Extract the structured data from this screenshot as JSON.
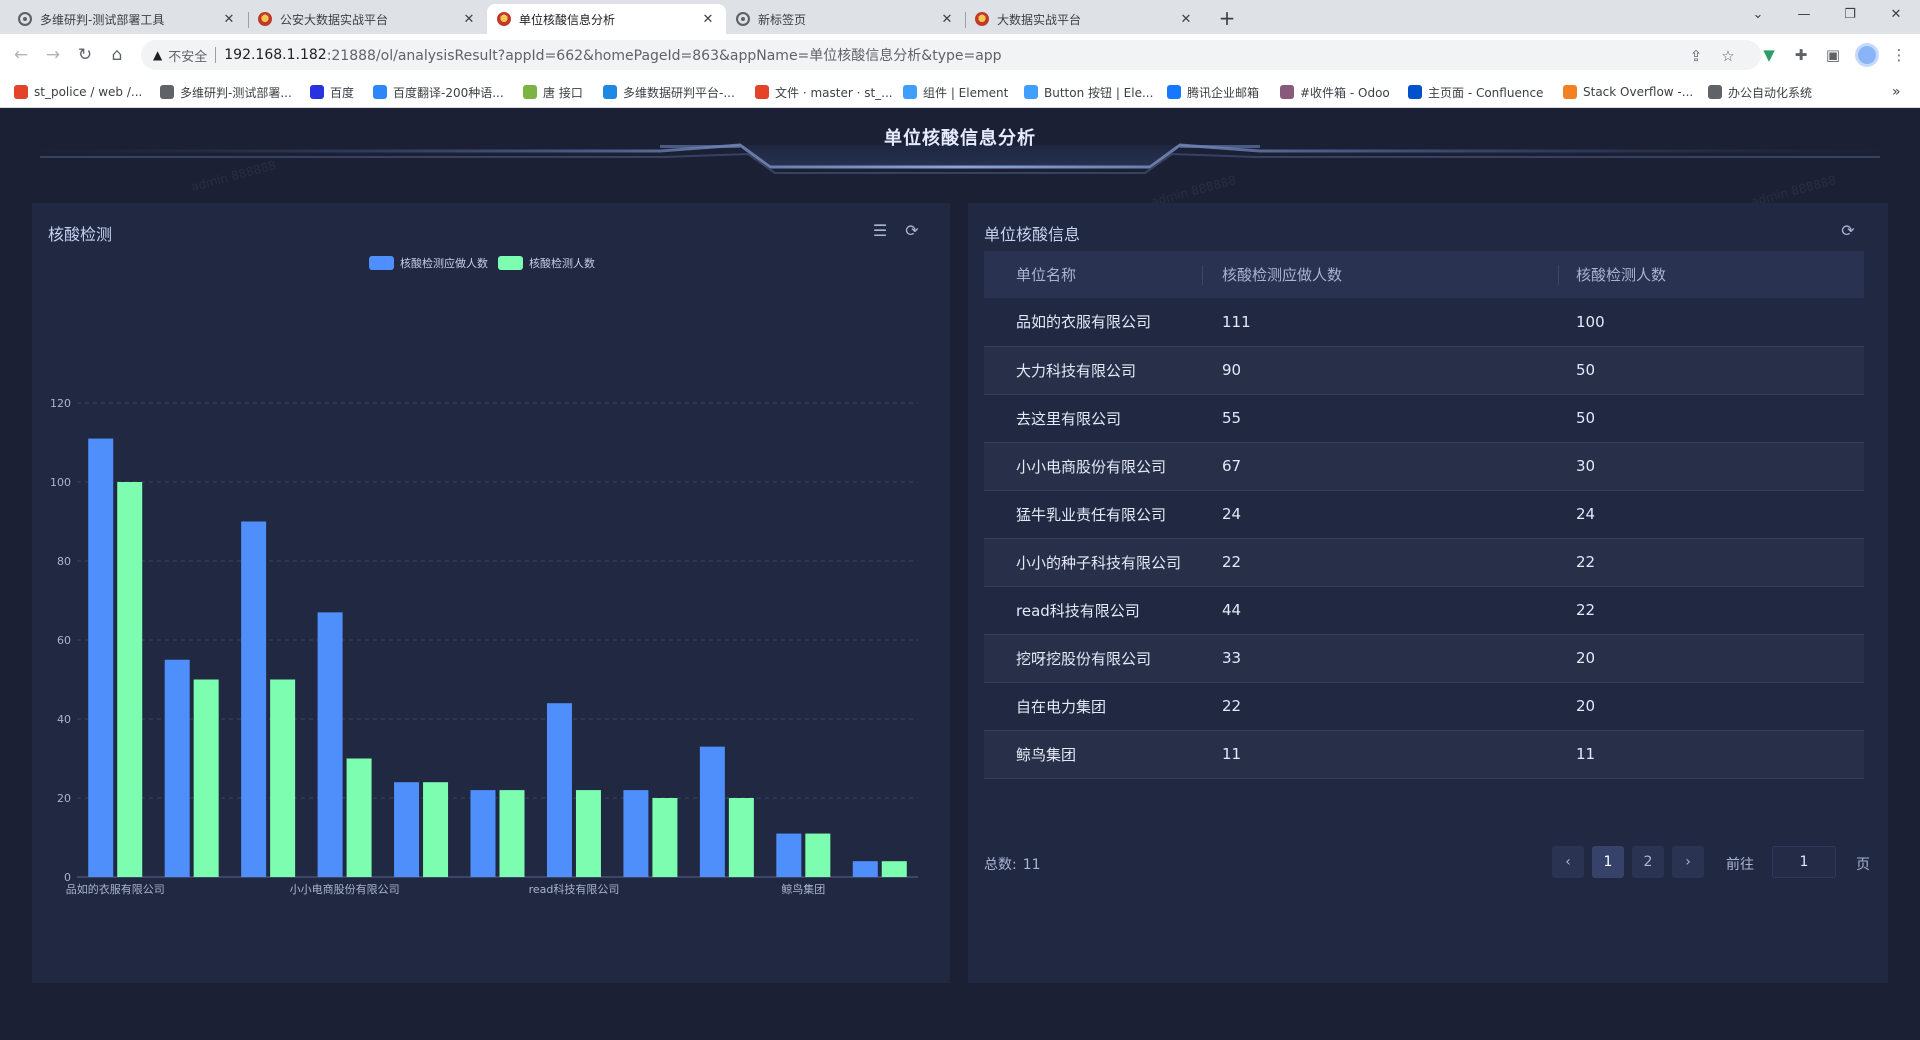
{
  "browser": {
    "tabs": [
      {
        "title": "多维研判-测试部署工具",
        "icon": "globe-icon",
        "active": false
      },
      {
        "title": "公安大数据实战平台",
        "icon": "police-badge-icon",
        "active": false
      },
      {
        "title": "单位核酸信息分析",
        "icon": "police-badge-icon",
        "active": true
      },
      {
        "title": "新标签页",
        "icon": "globe-icon",
        "active": false
      },
      {
        "title": "大数据实战平台",
        "icon": "police-badge-icon",
        "active": false
      }
    ],
    "security_label": "不安全",
    "url_host": "192.168.1.182",
    "url_rest": ":21888/ol/analysisResult?appId=662&homePageId=863&appName=单位核酸信息分析&type=app",
    "bookmarks": [
      {
        "label": "st_police / web /...",
        "color": "#e24329"
      },
      {
        "label": "多维研判-测试部署...",
        "color": "#5f6368"
      },
      {
        "label": "百度",
        "color": "#2932e1"
      },
      {
        "label": "百度翻译-200种语...",
        "color": "#2f86f6"
      },
      {
        "label": "唐 接口",
        "color": "#7cb342"
      },
      {
        "label": "多维数据研判平台-...",
        "color": "#1e88e5"
      },
      {
        "label": "文件 · master · st_...",
        "color": "#e24329"
      },
      {
        "label": "组件 | Element",
        "color": "#409eff"
      },
      {
        "label": "Button 按钮 | Ele...",
        "color": "#409eff"
      },
      {
        "label": "腾讯企业邮箱",
        "color": "#1677ff"
      },
      {
        "label": "#收件箱 - Odoo",
        "color": "#875a7b"
      },
      {
        "label": "主页面 - Confluence",
        "color": "#0052cc"
      },
      {
        "label": "Stack Overflow -...",
        "color": "#f48024"
      },
      {
        "label": "办公自动化系统",
        "color": "#5f6368"
      }
    ],
    "more_bookmarks": "»"
  },
  "app": {
    "title": "单位核酸信息分析",
    "watermark": "admin 888888"
  },
  "chart_panel": {
    "title": "核酸检测",
    "icons": [
      "list-icon",
      "refresh-icon"
    ]
  },
  "chart_data": {
    "type": "bar",
    "categories": [
      "品如的衣服有限公司",
      "大力科技有限公司",
      "去这里有限公司",
      "小小电商股份有限公司",
      "猛牛乳业责任有限公司",
      "小小的种子科技有限公司",
      "read科技有限公司",
      "挖呀挖股份有限公司",
      "自在电力集团",
      "鲸鸟集团",
      ""
    ],
    "visible_x_labels": [
      "品如的衣服有限公司",
      "小小电商股份有限公司",
      "read科技有限公司",
      "鲸鸟集团"
    ],
    "series": [
      {
        "name": "核酸检测应做人数",
        "color": "#4f8ffb",
        "values": [
          111,
          55,
          90,
          67,
          24,
          22,
          44,
          22,
          33,
          11,
          4
        ]
      },
      {
        "name": "核酸检测人数",
        "color": "#7dfdb0",
        "values": [
          100,
          50,
          50,
          30,
          24,
          22,
          22,
          20,
          20,
          11,
          4
        ]
      }
    ],
    "ylim": [
      0,
      120
    ],
    "yticks": [
      0,
      20,
      40,
      60,
      80,
      100,
      120
    ],
    "grid": true,
    "legend_position": "top-center"
  },
  "table_panel": {
    "title": "单位核酸信息",
    "columns": [
      "单位名称",
      "核酸检测应做人数",
      "核酸检测人数"
    ],
    "rows": [
      [
        "品如的衣服有限公司",
        "111",
        "100"
      ],
      [
        "大力科技有限公司",
        "90",
        "50"
      ],
      [
        "去这里有限公司",
        "55",
        "50"
      ],
      [
        "小小电商股份有限公司",
        "67",
        "30"
      ],
      [
        "猛牛乳业责任有限公司",
        "24",
        "24"
      ],
      [
        "小小的种子科技有限公司",
        "22",
        "22"
      ],
      [
        "read科技有限公司",
        "44",
        "22"
      ],
      [
        "挖呀挖股份有限公司",
        "33",
        "20"
      ],
      [
        "自在电力集团",
        "22",
        "20"
      ],
      [
        "鲸鸟集团",
        "11",
        "11"
      ]
    ],
    "pagination": {
      "total_label": "总数:",
      "total": "11",
      "pages": [
        "1",
        "2"
      ],
      "current_page": "1",
      "goto_label": "前往",
      "goto_value": "1",
      "page_suffix": "页"
    }
  }
}
